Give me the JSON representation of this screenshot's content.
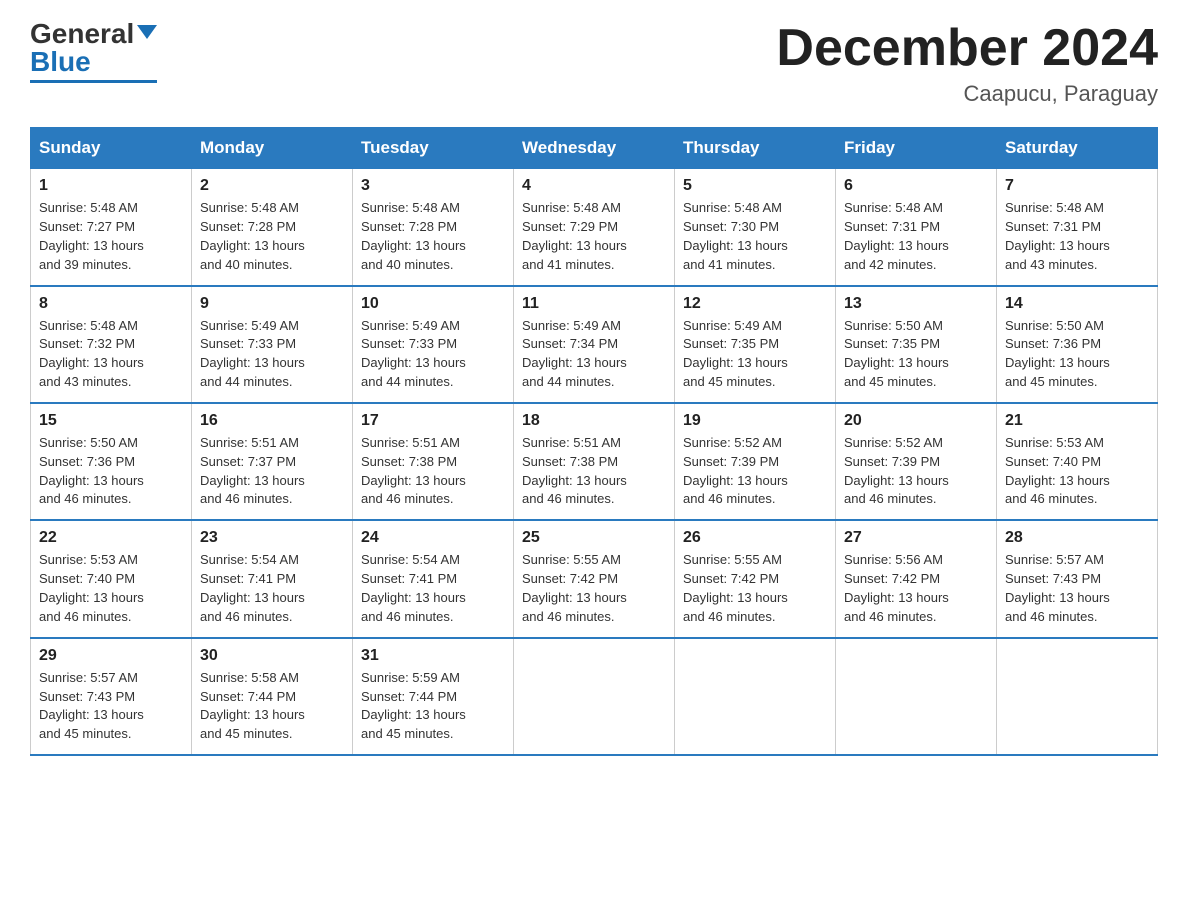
{
  "header": {
    "logo_general": "General",
    "logo_blue": "Blue",
    "month_title": "December 2024",
    "location": "Caapucu, Paraguay"
  },
  "days_of_week": [
    "Sunday",
    "Monday",
    "Tuesday",
    "Wednesday",
    "Thursday",
    "Friday",
    "Saturday"
  ],
  "weeks": [
    [
      {
        "day": "1",
        "sunrise": "5:48 AM",
        "sunset": "7:27 PM",
        "daylight": "13 hours and 39 minutes."
      },
      {
        "day": "2",
        "sunrise": "5:48 AM",
        "sunset": "7:28 PM",
        "daylight": "13 hours and 40 minutes."
      },
      {
        "day": "3",
        "sunrise": "5:48 AM",
        "sunset": "7:28 PM",
        "daylight": "13 hours and 40 minutes."
      },
      {
        "day": "4",
        "sunrise": "5:48 AM",
        "sunset": "7:29 PM",
        "daylight": "13 hours and 41 minutes."
      },
      {
        "day": "5",
        "sunrise": "5:48 AM",
        "sunset": "7:30 PM",
        "daylight": "13 hours and 41 minutes."
      },
      {
        "day": "6",
        "sunrise": "5:48 AM",
        "sunset": "7:31 PM",
        "daylight": "13 hours and 42 minutes."
      },
      {
        "day": "7",
        "sunrise": "5:48 AM",
        "sunset": "7:31 PM",
        "daylight": "13 hours and 43 minutes."
      }
    ],
    [
      {
        "day": "8",
        "sunrise": "5:48 AM",
        "sunset": "7:32 PM",
        "daylight": "13 hours and 43 minutes."
      },
      {
        "day": "9",
        "sunrise": "5:49 AM",
        "sunset": "7:33 PM",
        "daylight": "13 hours and 44 minutes."
      },
      {
        "day": "10",
        "sunrise": "5:49 AM",
        "sunset": "7:33 PM",
        "daylight": "13 hours and 44 minutes."
      },
      {
        "day": "11",
        "sunrise": "5:49 AM",
        "sunset": "7:34 PM",
        "daylight": "13 hours and 44 minutes."
      },
      {
        "day": "12",
        "sunrise": "5:49 AM",
        "sunset": "7:35 PM",
        "daylight": "13 hours and 45 minutes."
      },
      {
        "day": "13",
        "sunrise": "5:50 AM",
        "sunset": "7:35 PM",
        "daylight": "13 hours and 45 minutes."
      },
      {
        "day": "14",
        "sunrise": "5:50 AM",
        "sunset": "7:36 PM",
        "daylight": "13 hours and 45 minutes."
      }
    ],
    [
      {
        "day": "15",
        "sunrise": "5:50 AM",
        "sunset": "7:36 PM",
        "daylight": "13 hours and 46 minutes."
      },
      {
        "day": "16",
        "sunrise": "5:51 AM",
        "sunset": "7:37 PM",
        "daylight": "13 hours and 46 minutes."
      },
      {
        "day": "17",
        "sunrise": "5:51 AM",
        "sunset": "7:38 PM",
        "daylight": "13 hours and 46 minutes."
      },
      {
        "day": "18",
        "sunrise": "5:51 AM",
        "sunset": "7:38 PM",
        "daylight": "13 hours and 46 minutes."
      },
      {
        "day": "19",
        "sunrise": "5:52 AM",
        "sunset": "7:39 PM",
        "daylight": "13 hours and 46 minutes."
      },
      {
        "day": "20",
        "sunrise": "5:52 AM",
        "sunset": "7:39 PM",
        "daylight": "13 hours and 46 minutes."
      },
      {
        "day": "21",
        "sunrise": "5:53 AM",
        "sunset": "7:40 PM",
        "daylight": "13 hours and 46 minutes."
      }
    ],
    [
      {
        "day": "22",
        "sunrise": "5:53 AM",
        "sunset": "7:40 PM",
        "daylight": "13 hours and 46 minutes."
      },
      {
        "day": "23",
        "sunrise": "5:54 AM",
        "sunset": "7:41 PM",
        "daylight": "13 hours and 46 minutes."
      },
      {
        "day": "24",
        "sunrise": "5:54 AM",
        "sunset": "7:41 PM",
        "daylight": "13 hours and 46 minutes."
      },
      {
        "day": "25",
        "sunrise": "5:55 AM",
        "sunset": "7:42 PM",
        "daylight": "13 hours and 46 minutes."
      },
      {
        "day": "26",
        "sunrise": "5:55 AM",
        "sunset": "7:42 PM",
        "daylight": "13 hours and 46 minutes."
      },
      {
        "day": "27",
        "sunrise": "5:56 AM",
        "sunset": "7:42 PM",
        "daylight": "13 hours and 46 minutes."
      },
      {
        "day": "28",
        "sunrise": "5:57 AM",
        "sunset": "7:43 PM",
        "daylight": "13 hours and 46 minutes."
      }
    ],
    [
      {
        "day": "29",
        "sunrise": "5:57 AM",
        "sunset": "7:43 PM",
        "daylight": "13 hours and 45 minutes."
      },
      {
        "day": "30",
        "sunrise": "5:58 AM",
        "sunset": "7:44 PM",
        "daylight": "13 hours and 45 minutes."
      },
      {
        "day": "31",
        "sunrise": "5:59 AM",
        "sunset": "7:44 PM",
        "daylight": "13 hours and 45 minutes."
      },
      null,
      null,
      null,
      null
    ]
  ],
  "labels": {
    "sunrise": "Sunrise:",
    "sunset": "Sunset:",
    "daylight": "Daylight:"
  }
}
